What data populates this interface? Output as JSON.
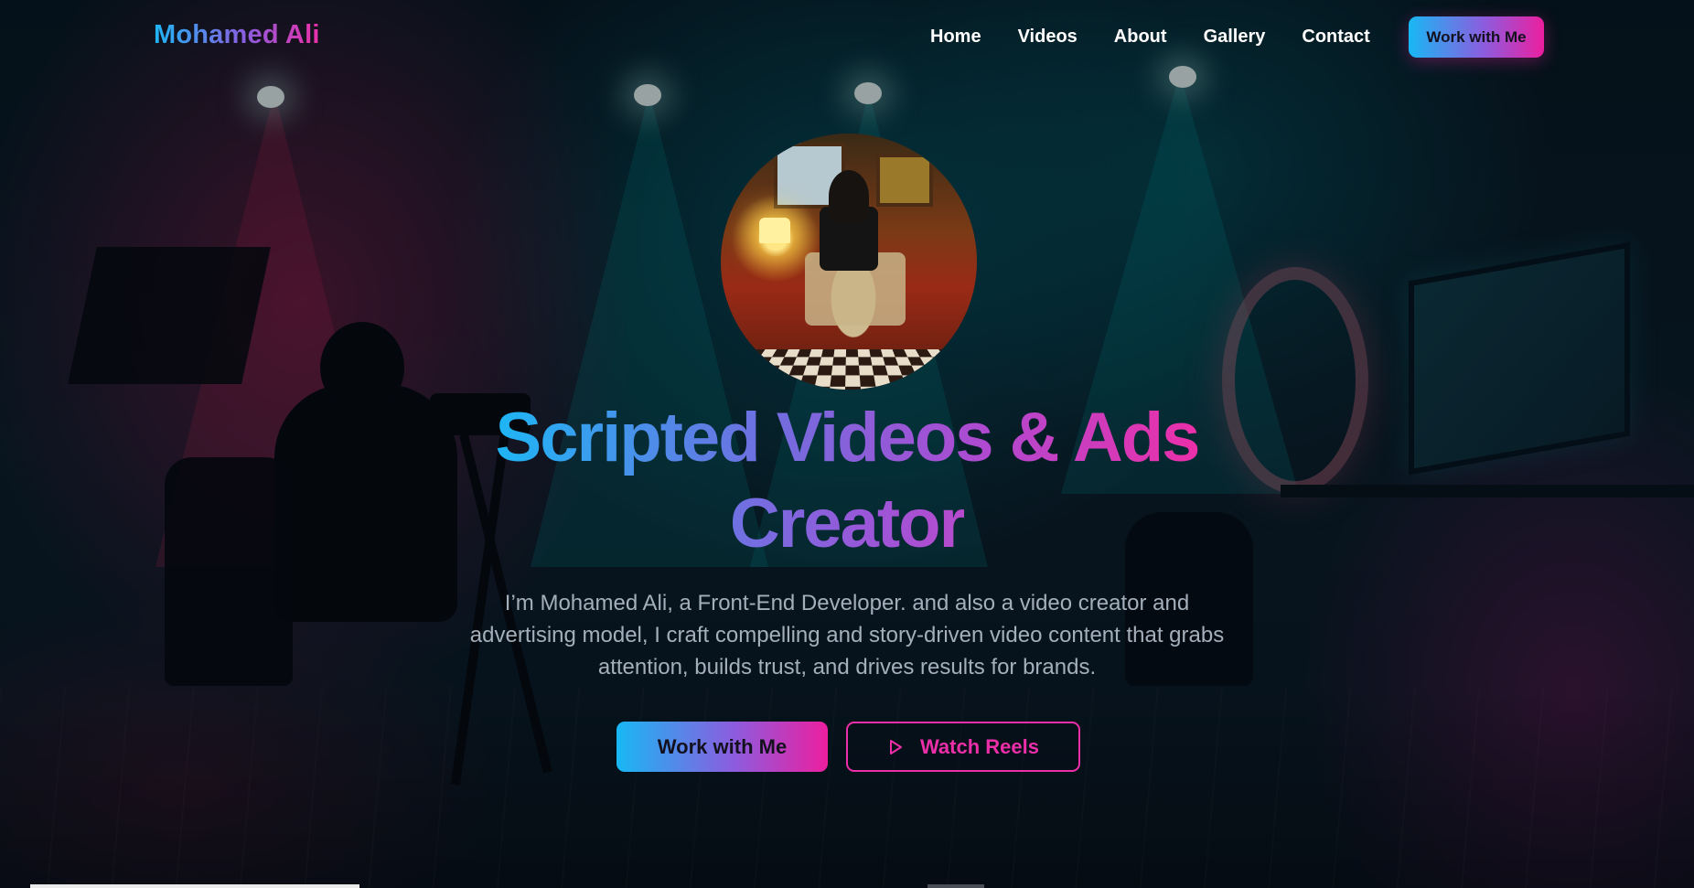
{
  "brand": {
    "name": "Mohamed Ali"
  },
  "nav": {
    "links": [
      "Home",
      "Videos",
      "About",
      "Gallery",
      "Contact"
    ],
    "cta_label": "Work with Me"
  },
  "hero": {
    "title_line1": "Scripted Videos & Ads",
    "title_line2": "Creator",
    "description": "I’m Mohamed Ali, a Front-End Developer. and also a video creator and advertising model, I craft compelling and story-driven video content that grabs attention, builds trust, and drives results for brands.",
    "primary_button": "Work with Me",
    "secondary_button": "Watch Reels",
    "secondary_button_icon": "play-icon"
  },
  "colors": {
    "gradient_start": "#1eb6f5",
    "gradient_mid": "#8b5ddf",
    "gradient_end": "#ec1f9f",
    "accent_pink": "#ec2fa8",
    "description_text": "#a4afbb",
    "background": "#07101a"
  }
}
